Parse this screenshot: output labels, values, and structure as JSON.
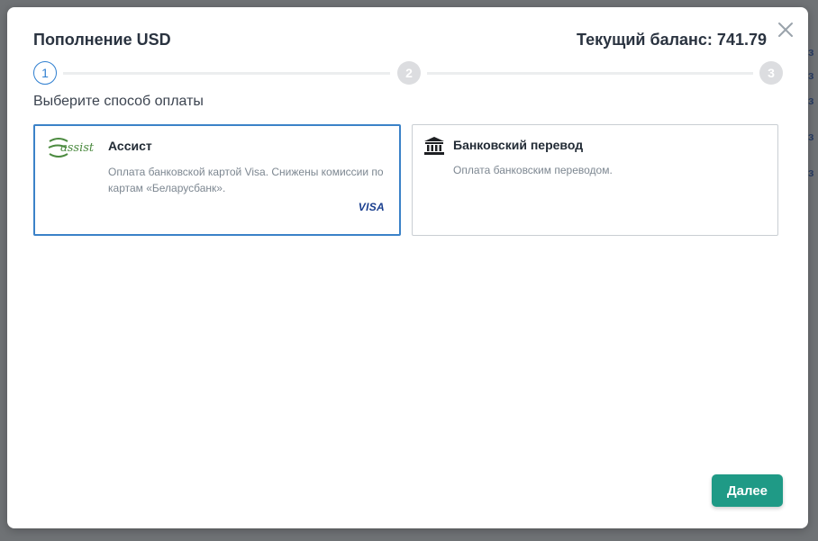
{
  "modal": {
    "title": "Пополнение USD",
    "balance_text": "Текущий баланс: 741.79",
    "subtitle": "Выберите способ оплаты",
    "next_label": "Далее"
  },
  "steps": [
    "1",
    "2",
    "3"
  ],
  "methods": [
    {
      "logo_text": "assist",
      "title": "Ассист",
      "description": "Оплата банковской картой Visa. Снижены комиссии по картам «Беларусбанк».",
      "badge": "VISA",
      "selected": true
    },
    {
      "title": "Банковский перевод",
      "description": "Оплата банковским переводом.",
      "selected": false
    }
  ],
  "colors": {
    "accent_blue": "#3b82c8",
    "button_green": "#1f9a86",
    "step_inactive": "#dcdde0",
    "assist_green": "#4b8a3f",
    "visa_blue": "#1a3f8f"
  }
}
